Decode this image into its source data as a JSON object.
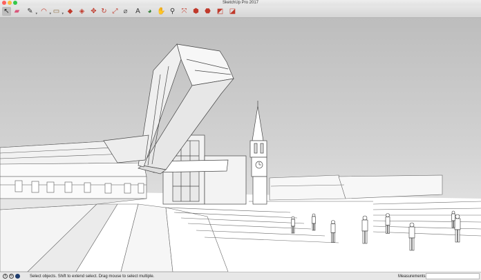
{
  "window": {
    "title": "SketchUp Pro 2017"
  },
  "toolbar": {
    "tools": [
      {
        "id": "select",
        "icon": "cursor-arrow-icon",
        "glyph": "↖",
        "color": "#222222",
        "active": true
      },
      {
        "id": "eraser",
        "icon": "eraser-icon",
        "glyph": "▰",
        "color": "#d9557a"
      },
      {
        "id": "line",
        "icon": "pencil-icon",
        "glyph": "✎",
        "color": "#333333",
        "dropdown": true
      },
      {
        "id": "arc",
        "icon": "arc-icon",
        "glyph": "◠",
        "color": "#c0392b",
        "dropdown": true
      },
      {
        "id": "shape",
        "icon": "rectangle-icon",
        "glyph": "▭",
        "color": "#8a6a3a",
        "dropdown": true
      },
      {
        "id": "push-pull",
        "icon": "push-pull-icon",
        "glyph": "◆",
        "color": "#c0392b"
      },
      {
        "id": "offset",
        "icon": "offset-icon",
        "glyph": "◈",
        "color": "#c0392b"
      },
      {
        "id": "move",
        "icon": "move-icon",
        "glyph": "✥",
        "color": "#c0392b"
      },
      {
        "id": "rotate",
        "icon": "rotate-icon",
        "glyph": "↻",
        "color": "#c0392b"
      },
      {
        "id": "scale",
        "icon": "scale-icon",
        "glyph": "⤢",
        "color": "#c0392b"
      },
      {
        "id": "tape-measure",
        "icon": "tape-measure-icon",
        "glyph": "⌀",
        "color": "#555555"
      },
      {
        "id": "text",
        "icon": "text-icon",
        "glyph": "A",
        "color": "#333333"
      },
      {
        "id": "paint-bucket",
        "icon": "paint-bucket-icon",
        "glyph": "◕",
        "color": "#2e7d32"
      },
      {
        "id": "orbit",
        "icon": "orbit-icon",
        "glyph": "✋",
        "color": "#444444"
      },
      {
        "id": "zoom",
        "icon": "zoom-icon",
        "glyph": "⚲",
        "color": "#333333"
      },
      {
        "id": "zoom-extents",
        "icon": "zoom-extents-icon",
        "glyph": "⤧",
        "color": "#c0392b"
      },
      {
        "id": "warehouse",
        "icon": "3d-warehouse-icon",
        "glyph": "⬢",
        "color": "#c0392b"
      },
      {
        "id": "extension-warehouse",
        "icon": "extension-warehouse-icon",
        "glyph": "⬣",
        "color": "#c0392b"
      },
      {
        "id": "layout",
        "icon": "send-to-layout-icon",
        "glyph": "◩",
        "color": "#c0392b"
      },
      {
        "id": "extension-manager",
        "icon": "extension-manager-icon",
        "glyph": "◪",
        "color": "#c0392b"
      }
    ]
  },
  "status": {
    "icons": [
      {
        "id": "geo-location",
        "icon": "geo-location-icon",
        "glyph": "i"
      },
      {
        "id": "credits",
        "icon": "credits-icon",
        "glyph": "©"
      },
      {
        "id": "user",
        "icon": "user-account-icon",
        "glyph": ""
      }
    ],
    "message": "Select objects. Shift to extend select. Drag mouse to select multiple.",
    "measurements_label": "Measurements",
    "measurements_value": ""
  },
  "colors": {
    "accent": "#c0392b",
    "sky_top": "#bdbdbd",
    "sky_bottom": "#f0f0f0",
    "model_line": "#444444"
  }
}
